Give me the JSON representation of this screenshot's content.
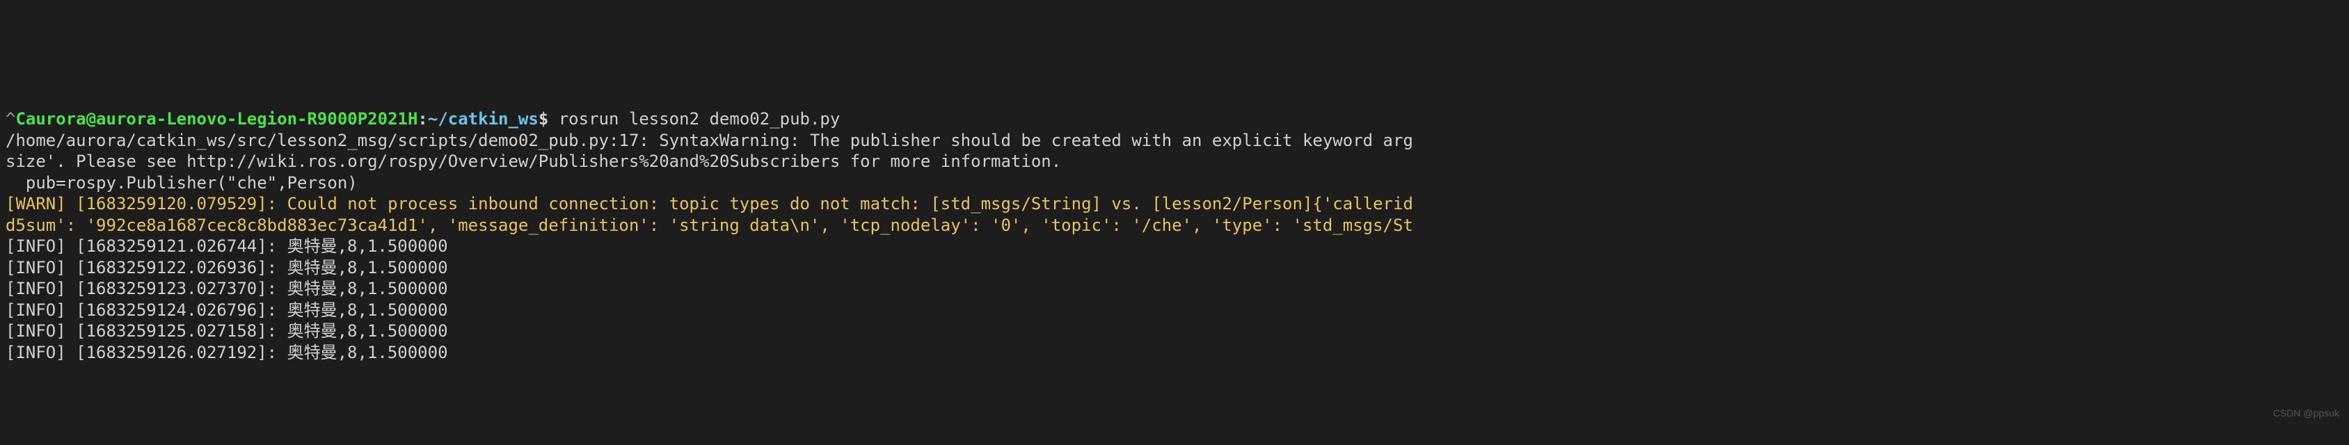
{
  "prompt": {
    "caret": "^",
    "user_host": "Caurora@aurora-Lenovo-Legion-R9000P2021H",
    "sep": ":",
    "path": "~/catkin_ws",
    "dollar": "$"
  },
  "command": " rosrun lesson2 demo02_pub.py",
  "output": {
    "line2": "/home/aurora/catkin_ws/src/lesson2_msg/scripts/demo02_pub.py:17: SyntaxWarning: The publisher should be created with an explicit keyword arg",
    "line3": "size'. Please see http://wiki.ros.org/rospy/Overview/Publishers%20and%20Subscribers for more information.",
    "line4": "  pub=rospy.Publisher(\"che\",Person)",
    "warn_line5": "[WARN] [1683259120.079529]: Could not process inbound connection: topic types do not match: [std_msgs/String] vs. [lesson2/Person]{'callerid",
    "warn_line6": "d5sum': '992ce8a1687cec8c8bd883ec73ca41d1', 'message_definition': 'string data\\n', 'tcp_nodelay': '0', 'topic': '/che', 'type': 'std_msgs/St",
    "info_lines": [
      "[INFO] [1683259121.026744]: 奥特曼,8,1.500000",
      "[INFO] [1683259122.026936]: 奥特曼,8,1.500000",
      "[INFO] [1683259123.027370]: 奥特曼,8,1.500000",
      "[INFO] [1683259124.026796]: 奥特曼,8,1.500000",
      "[INFO] [1683259125.027158]: 奥特曼,8,1.500000",
      "[INFO] [1683259126.027192]: 奥特曼,8,1.500000"
    ]
  },
  "watermark": "CSDN @ppsuk"
}
